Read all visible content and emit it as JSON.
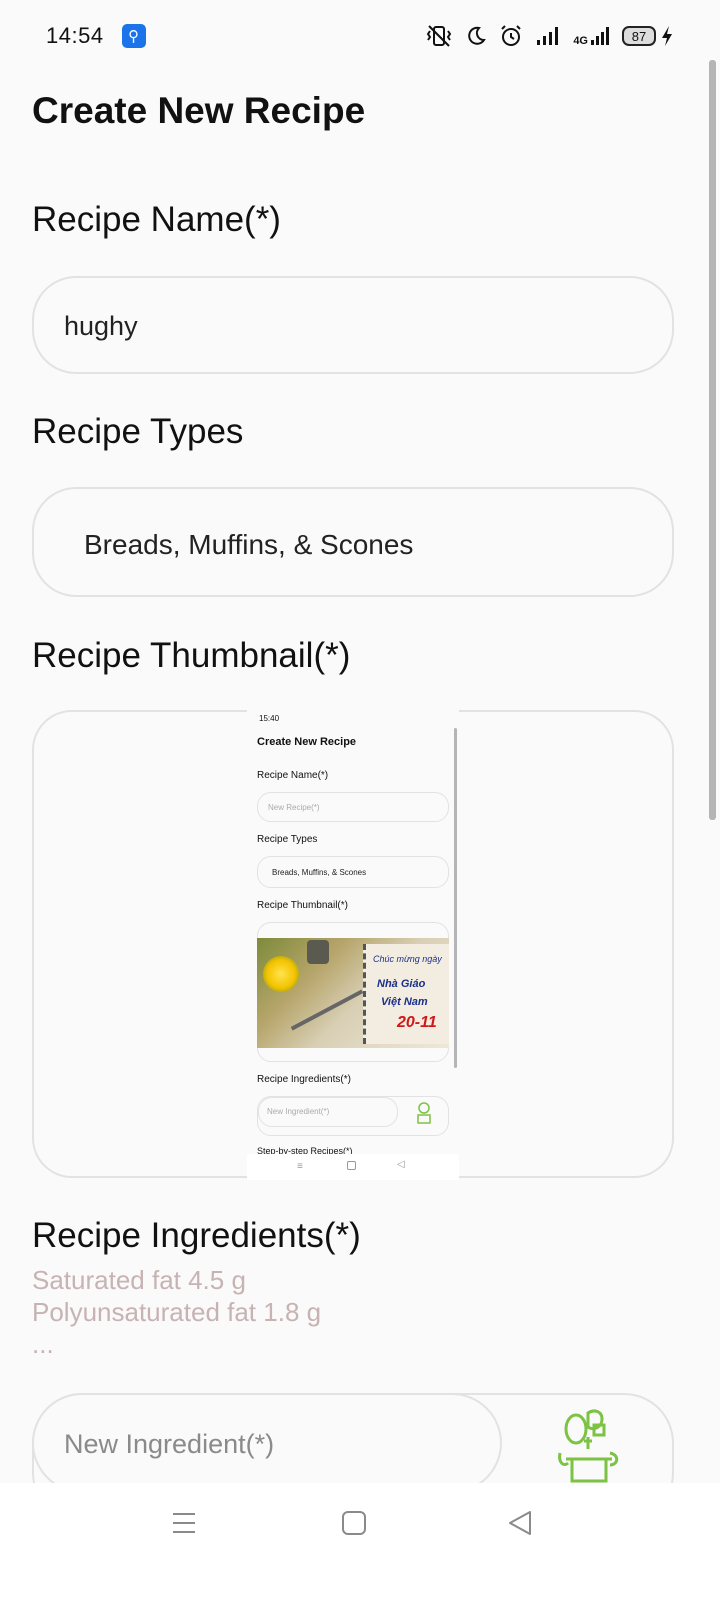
{
  "status_bar": {
    "time": "14:54",
    "network": "4G",
    "battery": "87",
    "icons": [
      "usb-icon",
      "vibrate-icon",
      "do-not-disturb-icon",
      "alarm-icon",
      "signal-icon",
      "battery-icon",
      "charging-icon"
    ]
  },
  "page": {
    "title": "Create New Recipe"
  },
  "recipe_name": {
    "label": "Recipe Name(*)",
    "value": "hughy"
  },
  "recipe_types": {
    "label": "Recipe Types",
    "selected": "Breads, Muffins, & Scones"
  },
  "recipe_thumbnail": {
    "label": "Recipe Thumbnail(*)",
    "preview": {
      "time": "15:40",
      "title": "Create New Recipe",
      "name_label": "Recipe Name(*)",
      "name_placeholder": "New Recipe(*)",
      "types_label": "Recipe Types",
      "types_value": "Breads, Muffins, & Scones",
      "thumbnail_label": "Recipe Thumbnail(*)",
      "photo_text_1": "Chúc mừng ngày",
      "photo_text_2": "Nhà Giáo",
      "photo_text_3": "Việt Nam",
      "photo_text_4": "20-11",
      "ingredients_label": "Recipe Ingredients(*)",
      "ingredient_placeholder": "New Ingredient(*)",
      "steps_label": "Step-by-step Recipes(*)"
    }
  },
  "recipe_ingredients": {
    "label": "Recipe Ingredients(*)",
    "hint_lines": [
      "Saturated fat 4.5 g",
      "Polyunsaturated fat 1.8 g",
      "..."
    ],
    "new_ingredient_placeholder": "New Ingredient(*)",
    "add_icon": "vegetable-basket-icon",
    "accent_color": "#7cc243"
  },
  "nav_bar": {
    "buttons": [
      "menu-icon",
      "home-icon",
      "back-icon"
    ]
  }
}
